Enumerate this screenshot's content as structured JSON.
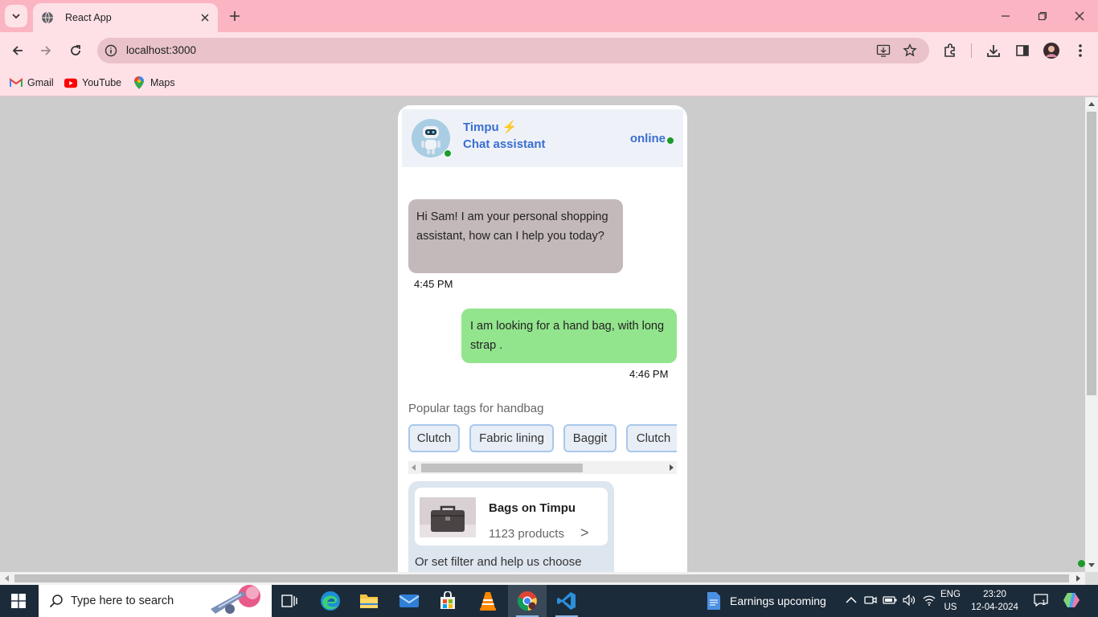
{
  "browser": {
    "tab_title": "React App",
    "url": "localhost:3000",
    "bookmarks": [
      {
        "label": "Gmail",
        "icon": "gmail-icon"
      },
      {
        "label": "YouTube",
        "icon": "youtube-icon"
      },
      {
        "label": "Maps",
        "icon": "maps-icon"
      }
    ]
  },
  "chat": {
    "bot_name": "Timpu",
    "bot_name_icon": "lightning-icon",
    "bot_subtitle": "Chat assistant",
    "status": "online",
    "status_color": "#1a9b2a",
    "accent_color": "#3a6ed1",
    "messages": [
      {
        "from": "bot",
        "text": "Hi Sam! I am your personal shopping assistant, how can I help you today?",
        "time": "4:45 PM",
        "bg": "#c4b9ba"
      },
      {
        "from": "user",
        "text": "I am looking for a hand bag, with long strap .",
        "time": "4:46 PM",
        "bg": "#93e58d"
      }
    ],
    "tags_title": "Popular tags for handbag",
    "tags": [
      "Clutch",
      "Fabric lining",
      "Baggit",
      "Clutch"
    ],
    "category_card": {
      "title": "Bags on Timpu",
      "count": "1123 products",
      "chevron": ">",
      "note": "Or set filter and help us choose"
    }
  },
  "taskbar": {
    "search_placeholder": "Type here to search",
    "news": "Earnings upcoming",
    "lang_line1": "ENG",
    "lang_line2": "US",
    "time": "23:20",
    "date": "12-04-2024",
    "notification_count": "1",
    "apps": [
      "task-view-icon",
      "edge-icon",
      "file-explorer-icon",
      "mail-icon",
      "store-icon",
      "vlc-icon",
      "chrome-icon",
      "vscode-icon"
    ]
  }
}
